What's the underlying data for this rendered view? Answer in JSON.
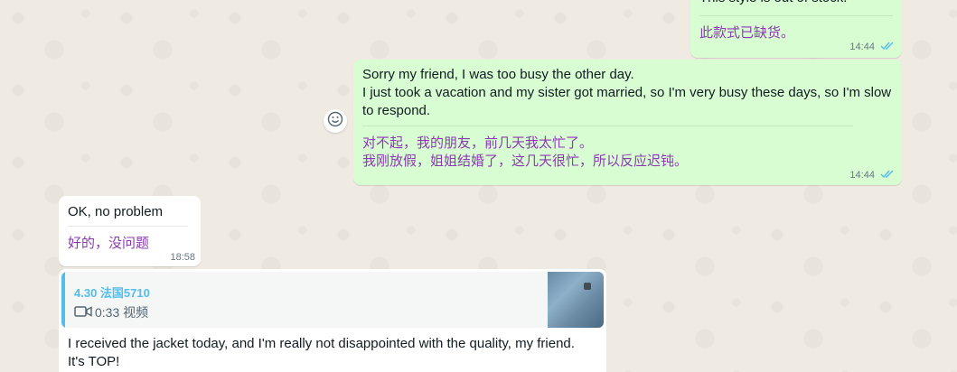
{
  "messages": [
    {
      "en": "This style is out of stock.",
      "zh": "此款式已缺货。",
      "time": "14:44"
    },
    {
      "en_lines": [
        "Sorry my friend, I was too busy the other day.",
        "I just took a vacation and my sister got married, so I'm very busy these days, so I'm slow",
        "to respond."
      ],
      "zh_lines": [
        "对不起，我的朋友，前几天我太忙了。",
        "我刚放假，姐姐结婚了，这几天很忙，所以反应迟钝。"
      ],
      "time": "14:44"
    },
    {
      "en": "OK, no problem",
      "zh": "好的，没问题",
      "time": "18:58"
    },
    {
      "quote": {
        "title": "4.30 法国5710",
        "media": "0:33 视频",
        "accent": "#53bdeb"
      },
      "en_lines": [
        "I received the jacket today, and I'm really not disappointed with the quality, my friend.",
        "It's TOP!"
      ]
    }
  ],
  "icons": {
    "emoji": "smiley-icon",
    "read_receipt": "double-check-icon",
    "video": "video-camera-icon"
  },
  "colors": {
    "outgoing_bubble": "#d9fdd3",
    "incoming_bubble": "#ffffff",
    "translation_text": "#8a3bb3",
    "read_ticks": "#53bdeb",
    "wallpaper": "#efeae2"
  }
}
